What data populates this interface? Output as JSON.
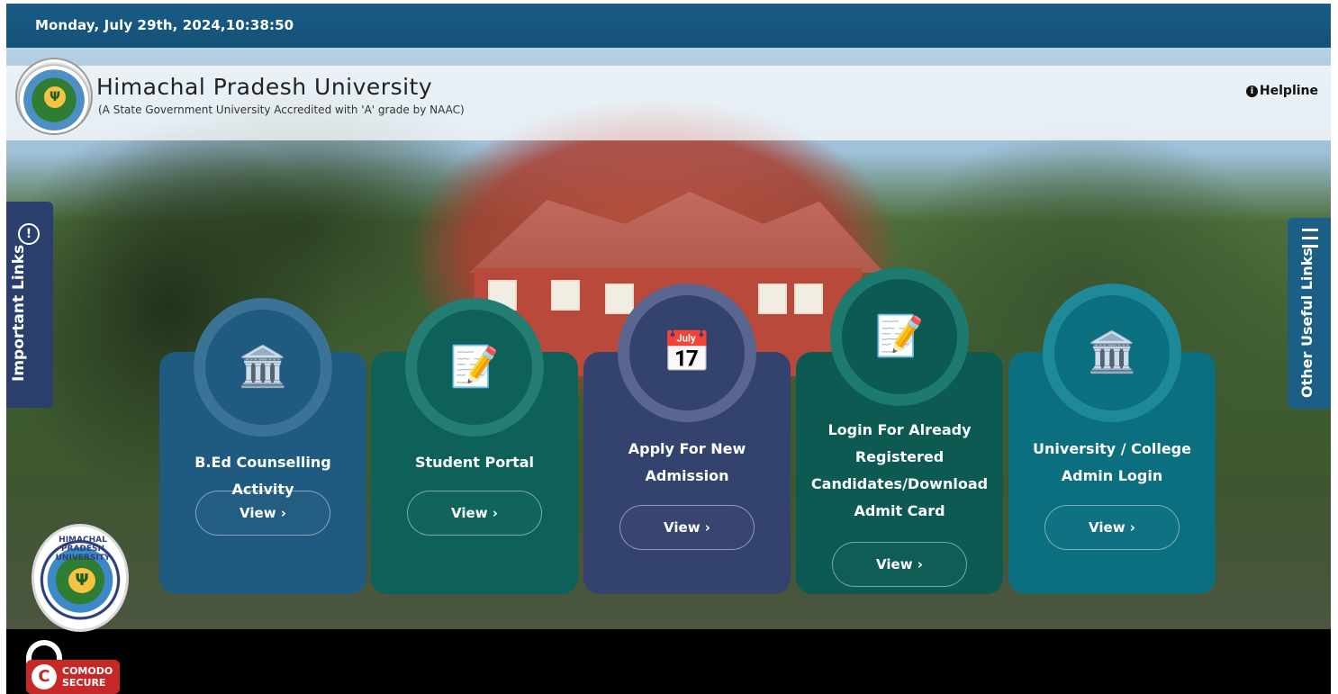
{
  "topbar": {
    "datetime": "Monday, July 29th, 2024,10:38:50"
  },
  "header": {
    "university_name": "Himachal Pradesh University",
    "subtitle": "(A State Government University Accredited with 'A' grade by NAAC)",
    "helpline_label": "Helpline",
    "helpline_icon": "info-icon"
  },
  "side_links": {
    "left_label": "Important Links",
    "left_icon": "alert-icon",
    "right_label": "Other Useful Links",
    "right_icon": "menu-icon"
  },
  "cards": [
    {
      "title": "B.Ed Counselling Activity",
      "button": "View ›",
      "icon": "building-icon",
      "color": "#1f5b80"
    },
    {
      "title": "Student Portal",
      "button": "View ›",
      "icon": "exam-icon",
      "color": "#0d6159"
    },
    {
      "title": "Apply For New Admission",
      "button": "View ›",
      "icon": "calendar-icon",
      "color": "#34426e"
    },
    {
      "title": "Login For Already Registered Candidates/Download Admit Card",
      "button": "View ›",
      "icon": "exam-icon",
      "color": "#0c5a52"
    },
    {
      "title": "University / College Admin Login",
      "button": "View ›",
      "icon": "building-icon",
      "color": "#0b6f7f"
    }
  ],
  "logo_text": "HIMACHAL PRADESH UNIVERSITY",
  "comodo": {
    "brand_top": "COMODO",
    "brand_bottom": "SECURE"
  }
}
